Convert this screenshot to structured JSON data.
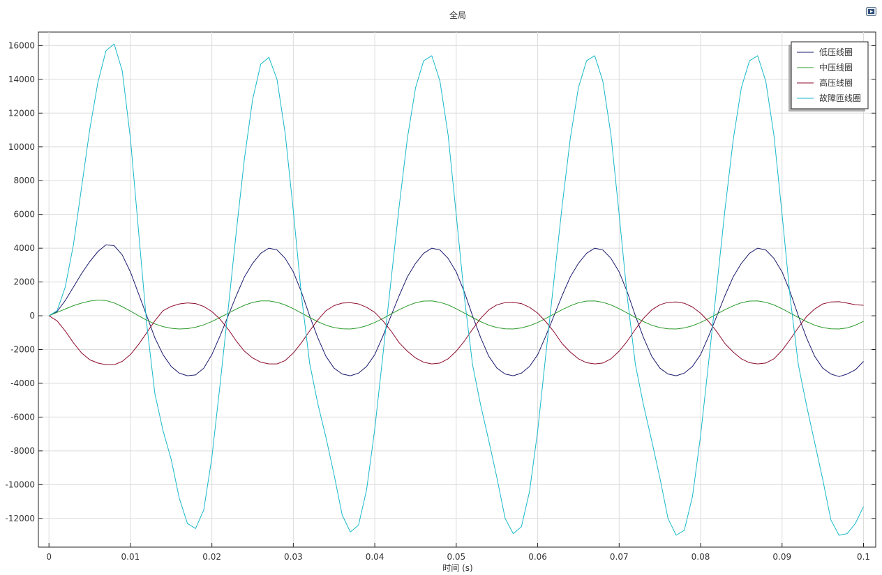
{
  "chart_data": {
    "type": "line",
    "title": "全局",
    "xlabel": "时间 (s)",
    "ylabel": "",
    "xlim": [
      -0.0013,
      0.1015
    ],
    "ylim": [
      -13700,
      16800
    ],
    "x_ticks": [
      0,
      0.01,
      0.02,
      0.03,
      0.04,
      0.05,
      0.06,
      0.07,
      0.08,
      0.09,
      0.1
    ],
    "x_tick_labels": [
      "0",
      "0.01",
      "0.02",
      "0.03",
      "0.04",
      "0.05",
      "0.06",
      "0.07",
      "0.08",
      "0.09",
      "0.1"
    ],
    "y_ticks": [
      -12000,
      -10000,
      -8000,
      -6000,
      -4000,
      -2000,
      0,
      2000,
      4000,
      6000,
      8000,
      10000,
      12000,
      14000,
      16000
    ],
    "y_tick_labels": [
      "-12000",
      "-10000",
      "-8000",
      "-6000",
      "-4000",
      "-2000",
      "0",
      "2000",
      "4000",
      "6000",
      "8000",
      "10000",
      "12000",
      "14000",
      "16000"
    ],
    "grid": true,
    "legend_position": "top-right",
    "series": [
      {
        "name": "低压线圈",
        "color": "#1a1a6e",
        "x": [
          0,
          0.001,
          0.002,
          0.003,
          0.004,
          0.005,
          0.006,
          0.007,
          0.008,
          0.009,
          0.01,
          0.011,
          0.012,
          0.013,
          0.014,
          0.015,
          0.016,
          0.017,
          0.018,
          0.019,
          0.02,
          0.021,
          0.022,
          0.023,
          0.024,
          0.025,
          0.026,
          0.027,
          0.028,
          0.029,
          0.03,
          0.031,
          0.032,
          0.033,
          0.034,
          0.035,
          0.036,
          0.037,
          0.038,
          0.039,
          0.04,
          0.041,
          0.042,
          0.043,
          0.044,
          0.045,
          0.046,
          0.047,
          0.048,
          0.049,
          0.05,
          0.051,
          0.052,
          0.053,
          0.054,
          0.055,
          0.056,
          0.057,
          0.058,
          0.059,
          0.06,
          0.061,
          0.062,
          0.063,
          0.064,
          0.065,
          0.066,
          0.067,
          0.068,
          0.069,
          0.07,
          0.071,
          0.072,
          0.073,
          0.074,
          0.075,
          0.076,
          0.077,
          0.078,
          0.079,
          0.08,
          0.081,
          0.082,
          0.083,
          0.084,
          0.085,
          0.086,
          0.087,
          0.088,
          0.089,
          0.09,
          0.091,
          0.092,
          0.093,
          0.094,
          0.095,
          0.096,
          0.097,
          0.098,
          0.099,
          0.1
        ],
        "values": [
          0,
          250,
          900,
          1700,
          2500,
          3200,
          3800,
          4200,
          4150,
          3600,
          2600,
          1300,
          0,
          -1300,
          -2300,
          -3000,
          -3400,
          -3550,
          -3500,
          -3100,
          -2300,
          -1200,
          0,
          1200,
          2300,
          3100,
          3700,
          4000,
          3900,
          3400,
          2600,
          1400,
          0,
          -1300,
          -2400,
          -3100,
          -3450,
          -3550,
          -3400,
          -3000,
          -2300,
          -1200,
          0,
          1200,
          2300,
          3100,
          3700,
          4000,
          3900,
          3400,
          2600,
          1400,
          0,
          -1300,
          -2400,
          -3100,
          -3450,
          -3550,
          -3400,
          -3000,
          -2300,
          -1200,
          0,
          1200,
          2300,
          3100,
          3700,
          4000,
          3900,
          3400,
          2600,
          1400,
          0,
          -1300,
          -2400,
          -3100,
          -3450,
          -3550,
          -3400,
          -3000,
          -2300,
          -1200,
          0,
          1200,
          2300,
          3100,
          3700,
          4000,
          3900,
          3400,
          2600,
          1400,
          0,
          -1300,
          -2400,
          -3100,
          -3450,
          -3600,
          -3450,
          -3200,
          -2700
        ]
      },
      {
        "name": "中压线圈",
        "color": "#2a9a2a",
        "x": [
          0,
          0.001,
          0.002,
          0.003,
          0.004,
          0.005,
          0.006,
          0.007,
          0.008,
          0.009,
          0.01,
          0.011,
          0.012,
          0.013,
          0.014,
          0.015,
          0.016,
          0.017,
          0.018,
          0.019,
          0.02,
          0.021,
          0.022,
          0.023,
          0.024,
          0.025,
          0.026,
          0.027,
          0.028,
          0.029,
          0.03,
          0.031,
          0.032,
          0.033,
          0.034,
          0.035,
          0.036,
          0.037,
          0.038,
          0.039,
          0.04,
          0.041,
          0.042,
          0.043,
          0.044,
          0.045,
          0.046,
          0.047,
          0.048,
          0.049,
          0.05,
          0.051,
          0.052,
          0.053,
          0.054,
          0.055,
          0.056,
          0.057,
          0.058,
          0.059,
          0.06,
          0.061,
          0.062,
          0.063,
          0.064,
          0.065,
          0.066,
          0.067,
          0.068,
          0.069,
          0.07,
          0.071,
          0.072,
          0.073,
          0.074,
          0.075,
          0.076,
          0.077,
          0.078,
          0.079,
          0.08,
          0.081,
          0.082,
          0.083,
          0.084,
          0.085,
          0.086,
          0.087,
          0.088,
          0.089,
          0.09,
          0.091,
          0.092,
          0.093,
          0.094,
          0.095,
          0.096,
          0.097,
          0.098,
          0.099,
          0.1
        ],
        "values": [
          0,
          200,
          400,
          600,
          750,
          870,
          930,
          900,
          760,
          540,
          280,
          0,
          -260,
          -480,
          -640,
          -740,
          -780,
          -760,
          -680,
          -540,
          -340,
          -100,
          150,
          400,
          620,
          790,
          880,
          880,
          800,
          640,
          420,
          160,
          -100,
          -350,
          -560,
          -700,
          -770,
          -780,
          -720,
          -590,
          -400,
          -160,
          100,
          360,
          590,
          770,
          870,
          880,
          800,
          640,
          420,
          160,
          -100,
          -350,
          -560,
          -700,
          -770,
          -780,
          -720,
          -590,
          -400,
          -160,
          100,
          360,
          590,
          770,
          870,
          880,
          800,
          640,
          420,
          160,
          -100,
          -350,
          -560,
          -700,
          -770,
          -780,
          -720,
          -590,
          -400,
          -160,
          100,
          360,
          590,
          770,
          870,
          880,
          800,
          640,
          420,
          160,
          -100,
          -350,
          -560,
          -700,
          -770,
          -780,
          -720,
          -560,
          -330
        ]
      },
      {
        "name": "高压线圈",
        "color": "#8b0a2a",
        "x": [
          0,
          0.001,
          0.002,
          0.003,
          0.004,
          0.005,
          0.006,
          0.007,
          0.008,
          0.009,
          0.01,
          0.011,
          0.012,
          0.013,
          0.014,
          0.015,
          0.016,
          0.017,
          0.018,
          0.019,
          0.02,
          0.021,
          0.022,
          0.023,
          0.024,
          0.025,
          0.026,
          0.027,
          0.028,
          0.029,
          0.03,
          0.031,
          0.032,
          0.033,
          0.034,
          0.035,
          0.036,
          0.037,
          0.038,
          0.039,
          0.04,
          0.041,
          0.042,
          0.043,
          0.044,
          0.045,
          0.046,
          0.047,
          0.048,
          0.049,
          0.05,
          0.051,
          0.052,
          0.053,
          0.054,
          0.055,
          0.056,
          0.057,
          0.058,
          0.059,
          0.06,
          0.061,
          0.062,
          0.063,
          0.064,
          0.065,
          0.066,
          0.067,
          0.068,
          0.069,
          0.07,
          0.071,
          0.072,
          0.073,
          0.074,
          0.075,
          0.076,
          0.077,
          0.078,
          0.079,
          0.08,
          0.081,
          0.082,
          0.083,
          0.084,
          0.085,
          0.086,
          0.087,
          0.088,
          0.089,
          0.09,
          0.091,
          0.092,
          0.093,
          0.094,
          0.095,
          0.096,
          0.097,
          0.098,
          0.099,
          0.1
        ],
        "values": [
          0,
          -300,
          -900,
          -1600,
          -2200,
          -2600,
          -2800,
          -2900,
          -2900,
          -2700,
          -2300,
          -1700,
          -1000,
          -300,
          300,
          550,
          700,
          760,
          720,
          550,
          250,
          -200,
          -800,
          -1500,
          -2100,
          -2500,
          -2750,
          -2850,
          -2850,
          -2650,
          -2200,
          -1600,
          -900,
          -250,
          300,
          600,
          750,
          780,
          700,
          500,
          200,
          -300,
          -900,
          -1600,
          -2100,
          -2500,
          -2750,
          -2850,
          -2800,
          -2550,
          -2100,
          -1500,
          -800,
          -150,
          350,
          650,
          780,
          800,
          720,
          500,
          150,
          -350,
          -950,
          -1650,
          -2150,
          -2550,
          -2780,
          -2850,
          -2800,
          -2550,
          -2100,
          -1500,
          -800,
          -150,
          350,
          650,
          800,
          820,
          740,
          520,
          150,
          -350,
          -950,
          -1650,
          -2150,
          -2550,
          -2780,
          -2850,
          -2800,
          -2550,
          -2050,
          -1400,
          -700,
          -50,
          400,
          700,
          820,
          830,
          750,
          650,
          620
        ]
      },
      {
        "name": "故障匝线圈",
        "color": "#17b8c8",
        "x": [
          0,
          0.001,
          0.002,
          0.003,
          0.004,
          0.005,
          0.006,
          0.007,
          0.008,
          0.009,
          0.01,
          0.011,
          0.012,
          0.013,
          0.014,
          0.015,
          0.016,
          0.017,
          0.018,
          0.019,
          0.02,
          0.021,
          0.022,
          0.023,
          0.024,
          0.025,
          0.026,
          0.027,
          0.028,
          0.029,
          0.03,
          0.031,
          0.032,
          0.033,
          0.034,
          0.035,
          0.036,
          0.037,
          0.038,
          0.039,
          0.04,
          0.041,
          0.042,
          0.043,
          0.044,
          0.045,
          0.046,
          0.047,
          0.048,
          0.049,
          0.05,
          0.051,
          0.052,
          0.053,
          0.054,
          0.055,
          0.056,
          0.057,
          0.058,
          0.059,
          0.06,
          0.061,
          0.062,
          0.063,
          0.064,
          0.065,
          0.066,
          0.067,
          0.068,
          0.069,
          0.07,
          0.071,
          0.072,
          0.073,
          0.074,
          0.075,
          0.076,
          0.077,
          0.078,
          0.079,
          0.08,
          0.081,
          0.082,
          0.083,
          0.084,
          0.085,
          0.086,
          0.087,
          0.088,
          0.089,
          0.09,
          0.091,
          0.092,
          0.093,
          0.094,
          0.095,
          0.096,
          0.097,
          0.098,
          0.099,
          0.1
        ],
        "values": [
          0,
          300,
          1700,
          4200,
          7600,
          11000,
          13800,
          15700,
          16100,
          14500,
          10500,
          5000,
          -500,
          -4600,
          -6800,
          -8500,
          -10800,
          -12300,
          -12600,
          -11500,
          -8400,
          -4100,
          400,
          5000,
          9300,
          12800,
          14900,
          15300,
          14000,
          10800,
          6200,
          1200,
          -2800,
          -5200,
          -7200,
          -9400,
          -11800,
          -12800,
          -12400,
          -10300,
          -6700,
          -2300,
          2100,
          6500,
          10500,
          13500,
          15100,
          15400,
          13900,
          10700,
          6000,
          1100,
          -2900,
          -5300,
          -7400,
          -9600,
          -12000,
          -12900,
          -12500,
          -10400,
          -6800,
          -2300,
          2100,
          6500,
          10500,
          13500,
          15100,
          15400,
          13900,
          10700,
          6000,
          1100,
          -2900,
          -5300,
          -7400,
          -9600,
          -12000,
          -13000,
          -12700,
          -10700,
          -7100,
          -2700,
          1800,
          6300,
          10400,
          13500,
          15100,
          15400,
          13900,
          10700,
          6000,
          1100,
          -2900,
          -5300,
          -7500,
          -9700,
          -12100,
          -13000,
          -12900,
          -12300,
          -11300
        ]
      }
    ]
  },
  "ui": {
    "export_icon": "camera-export-icon"
  }
}
